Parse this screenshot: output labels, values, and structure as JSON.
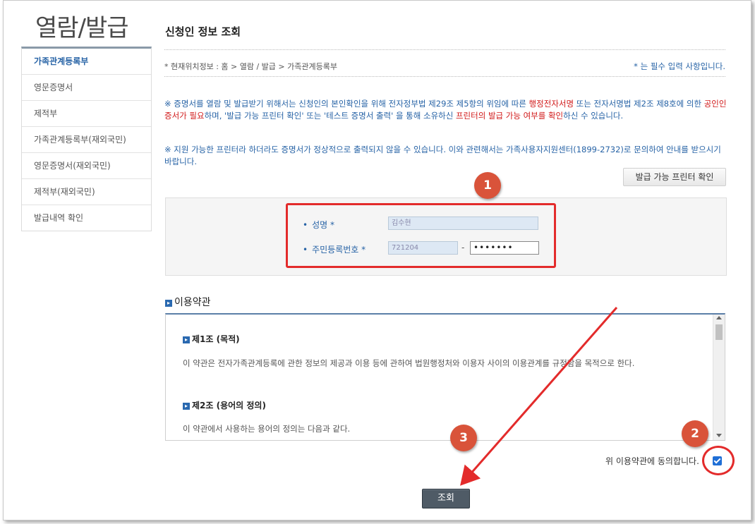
{
  "sidebar": {
    "title": "열람/발급",
    "items": [
      {
        "label": "가족관계등록부",
        "active": true
      },
      {
        "label": "영문증명서"
      },
      {
        "label": "제적부"
      },
      {
        "label": "가족관계등록부(재외국민)"
      },
      {
        "label": "영문증명서(재외국민)"
      },
      {
        "label": "제적부(재외국민)"
      },
      {
        "label": "발급내역 확인"
      }
    ]
  },
  "main": {
    "title": "신청인 정보 조회",
    "breadcrumb": "* 현재위치정보 : 홈 > 열람 / 발급 > 가족관계등록부",
    "required_note": "* 는 필수 입력 사항입니다.",
    "notice1": {
      "p1": "※ 증명서를 열람 및 발급받기 위해서는 신청인의 본인확인을 위해 전자정부법 제29조 제5항의 위임에 따른 ",
      "r1": "행정전자서명",
      "p2": " 또는 전자서명법 제2조 제8호에 의한 ",
      "r2": "공인인증서가 필요",
      "p3": "하며, '발급 가능 프린터 확인' 또는 '테스트 증명서 출력' 을 통해 소유하신 ",
      "r3": "프린터의 발급 가능 여부를 확인",
      "p4": "하신 수 있습니다."
    },
    "notice2": "※ 지원 가능한 프린터라 하더라도 증명서가 정상적으로 출력되지 않을 수 있습니다. 이와 관련해서는 가족사용자지원센터(1899-2732)로 문의하여 안내를 받으시기 바랍니다.",
    "printer_button": "발급 가능 프린터 확인"
  },
  "form": {
    "bullet": "•",
    "name_label": "성명",
    "name_value": "김수현",
    "rrn_label": "주민등록번호",
    "rrn_front": "721204",
    "rrn_separator": "-",
    "rrn_back": "•••••••",
    "required_mark": "*"
  },
  "terms": {
    "section_title": "이용약관",
    "art1_title": "제1조 (목적)",
    "art1_text": "이 약관은 전자가족관계등록에 관한 정보의 제공과 이용 등에 관하여 법원행정처와 이용자 사이의 이용관계를 규정함을 목적으로 한다.",
    "art2_title": "제2조 (용어의 정의)",
    "art2_text": "이 약관에서 사용하는 용어의 정의는 다음과 같다.",
    "agree_label": "위 이용약관에 동의합니다.",
    "agree_checked": true
  },
  "submit_button": "조회",
  "badges": {
    "b1": "1",
    "b2": "2",
    "b3": "3"
  },
  "colors": {
    "highlight": "#e32b2b",
    "badge": "#d9533a",
    "link_blue": "#2763a6",
    "emphasis_red": "#d11a1a"
  }
}
